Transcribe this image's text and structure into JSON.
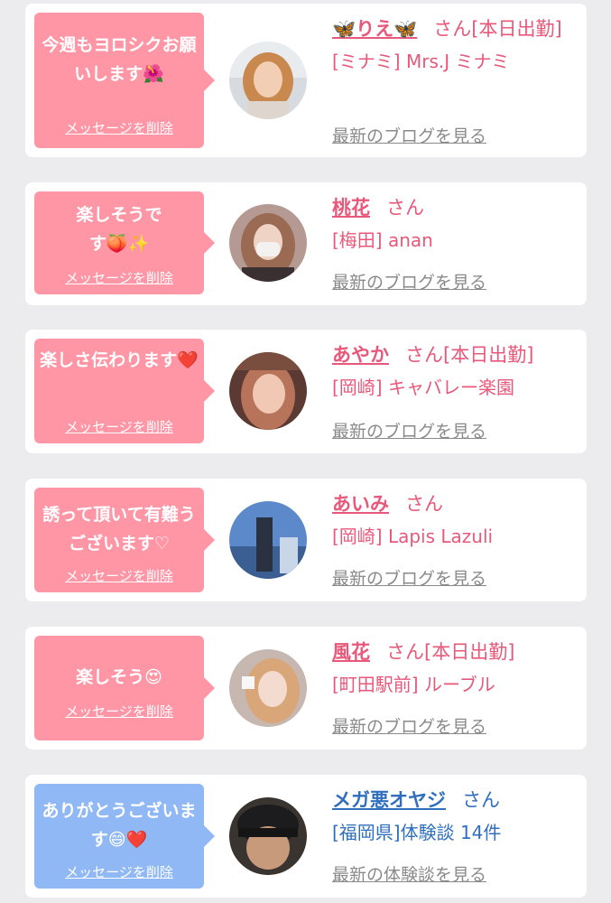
{
  "messages": [
    {
      "bubble_color": "#ff96a6",
      "message": "今週もヨロシクお願いします🌺",
      "delete_label": "メッセージを削除",
      "name": "🦋りえ🦋",
      "honorific": "さん[本日出勤]",
      "shop": "[ミナミ] Mrs.J ミナミ",
      "link": "最新のブログを見る"
    },
    {
      "bubble_color": "#ff96a6",
      "message": "楽しそうです🍑✨",
      "delete_label": "メッセージを削除",
      "name": "桃花",
      "honorific": "さん",
      "shop": "[梅田] anan",
      "link": "最新のブログを見る"
    },
    {
      "bubble_color": "#ff96a6",
      "message": "楽しさ伝わります❤️",
      "delete_label": "メッセージを削除",
      "name": "あやか",
      "honorific": "さん[本日出勤]",
      "shop": "[岡崎] キャバレー楽園",
      "link": "最新のブログを見る"
    },
    {
      "bubble_color": "#ff96a6",
      "message": "誘って頂いて有難うございます♡",
      "delete_label": "メッセージを削除",
      "name": "あいみ",
      "honorific": "さん",
      "shop": "[岡崎] Lapis Lazuli",
      "link": "最新のブログを見る"
    },
    {
      "bubble_color": "#ff96a6",
      "message": "楽しそう😍",
      "delete_label": "メッセージを削除",
      "name": "風花",
      "honorific": "さん[本日出勤]",
      "shop": "[町田駅前] ルーブル",
      "link": "最新のブログを見る"
    },
    {
      "bubble_color": "#8fb8f5",
      "message": "ありがとうございます😄❤️",
      "delete_label": "メッセージを削除",
      "name": "メガ悪オヤジ",
      "honorific": "さん",
      "shop": "[福岡県]体験談 14件",
      "link": "最新の体験談を見る"
    }
  ]
}
